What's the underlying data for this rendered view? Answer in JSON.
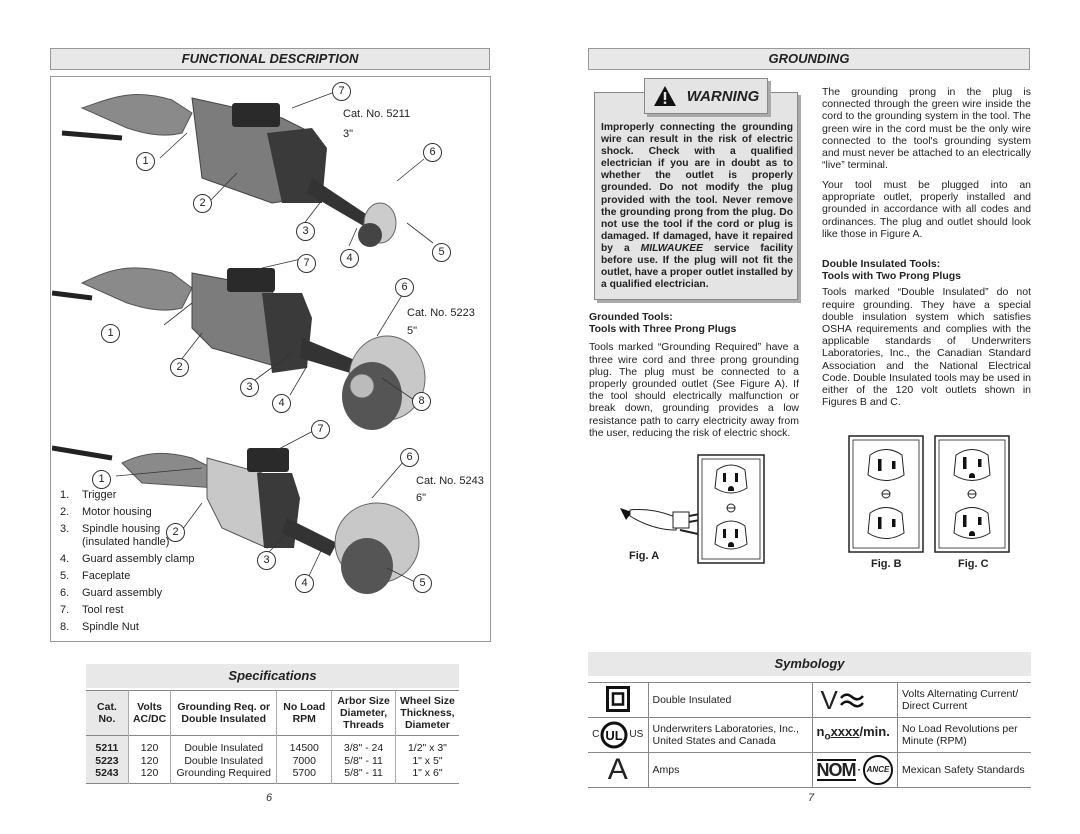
{
  "left_page": {
    "section_title": "FUNCTIONAL DESCRIPTION",
    "tools": [
      {
        "cat_label": "Cat. No. 5211",
        "size": "3\"",
        "callouts": [
          "1",
          "2",
          "3",
          "4",
          "5",
          "6",
          "7"
        ]
      },
      {
        "cat_label": "Cat. No. 5223",
        "size": "5\"",
        "callouts": [
          "1",
          "2",
          "3",
          "4",
          "6",
          "7",
          "8"
        ]
      },
      {
        "cat_label": "Cat. No. 5243",
        "size": "6\"",
        "callouts": [
          "1",
          "2",
          "3",
          "4",
          "5",
          "6",
          "7"
        ]
      }
    ],
    "parts": [
      {
        "num": "1.",
        "label": "Trigger"
      },
      {
        "num": "2.",
        "label": "Motor housing"
      },
      {
        "num": "3.",
        "label": "Spindle housing (insulated handle)"
      },
      {
        "num": "4.",
        "label": "Guard assembly clamp"
      },
      {
        "num": "5.",
        "label": "Faceplate"
      },
      {
        "num": "6.",
        "label": "Guard assembly"
      },
      {
        "num": "7.",
        "label": "Tool rest"
      },
      {
        "num": "8.",
        "label": "Spindle Nut"
      }
    ],
    "specifications": {
      "title": "Specifications",
      "headers": [
        "Cat. No.",
        "Volts AC/DC",
        "Grounding Req. or Double Insulated",
        "No Load RPM",
        "Arbor Size Diameter, Threads",
        "Wheel Size Thickness, Diameter"
      ],
      "rows": [
        [
          "5211",
          "120",
          "Double Insulated",
          "14500",
          "3/8\" - 24",
          "1/2\" x 3\""
        ],
        [
          "5223",
          "120",
          "Double Insulated",
          "7000",
          "5/8\" - 11",
          "1\" x 5\""
        ],
        [
          "5243",
          "120",
          "Grounding Required",
          "5700",
          "5/8\" - 11",
          "1\" x 6\""
        ]
      ]
    },
    "page_number": "6"
  },
  "right_page": {
    "section_title": "GROUNDING",
    "warning": {
      "title": "WARNING",
      "text_before": "Improperly connecting the grounding wire can result in the risk of electric shock. Check with a qualified electrician if you are in doubt as to whether the outlet is properly grounded. Do not modify the plug provided with the tool. Never remove the grounding prong from the plug. Do not use the tool if the cord or plug is damaged. If damaged, have it repaired by a ",
      "brand": "MILWAUKEE",
      "text_after": " service facility before use. If the plug will not fit the outlet, have a proper outlet installed by a qualified electrician."
    },
    "grounded_tools": {
      "heading1": "Grounded Tools:",
      "heading2": "Tools with Three Prong Plugs",
      "text": "Tools marked “Grounding Required” have a three wire cord and three prong grounding plug. The plug must be connected to a properly grounded outlet (See Figure A). If the tool should electrically malfunction or break down, grounding provides a low resistance path to carry electricity away from the user, reducing the risk of electric shock."
    },
    "para1": "The grounding prong in the plug is connected through the green wire inside the cord to the grounding system in the tool. The green wire in the cord must be the only wire connected to the tool's grounding system and must never be attached to an electrically “live” terminal.",
    "para2": "Your tool must be plugged into an appropriate outlet, properly installed and grounded in accordance with all codes and ordinances. The plug and outlet should look like those in Figure A.",
    "double_insulated": {
      "heading1": "Double Insulated Tools:",
      "heading2": "Tools with Two Prong Plugs",
      "text": "Tools marked “Double Insulated” do not require grounding. They have a special double insulation system which satisfies OSHA requirements and complies with the applicable standards of Underwriters Laboratories, Inc., the Canadian Standard Association and the National Electrical Code. Double Insulated tools may be used in either of the 120 volt outlets shown in Figures B and C."
    },
    "figures": {
      "a": "Fig. A",
      "b": "Fig. B",
      "c": "Fig. C"
    },
    "symbology": {
      "title": "Symbology",
      "rows": [
        {
          "left_icon": "double-insulated-icon",
          "left_text": "Double Insulated",
          "right_icon": "volts-ac-dc-icon",
          "right_text": "Volts Alternating Current/ Direct Current"
        },
        {
          "left_icon": "ul-listed-icon",
          "left_text": "Underwriters Laboratories, Inc., United States and Canada",
          "right_icon": "no-load-rpm-icon",
          "right_text": "No Load Revolutions per Minute (RPM)"
        },
        {
          "left_icon": "amps-icon",
          "left_text": "Amps",
          "right_icon": "nom-ance-icon",
          "right_text": "Mexican Safety Standards"
        }
      ],
      "ul_c": "C",
      "ul_us": "US",
      "rpm_prefix": "n",
      "rpm_sub": "o",
      "rpm_value": "xxxx",
      "rpm_unit": "/min.",
      "amps_symbol": "A",
      "volts_symbol": "V",
      "nom_text": "NOM",
      "ance_text": "ANCE"
    },
    "page_number": "7"
  }
}
